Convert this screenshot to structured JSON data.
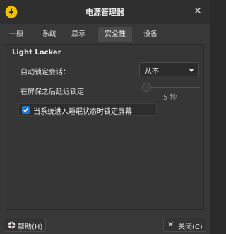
{
  "window": {
    "title": "电源管理器"
  },
  "tabs": [
    "一般",
    "系统",
    "显示",
    "安全性",
    "设备"
  ],
  "active_tab": "安全性",
  "section": {
    "title": "Light Locker"
  },
  "auto_lock": {
    "label": "自动锁定会话：",
    "value": "从不"
  },
  "delay": {
    "label": "在屏保之后延迟锁定",
    "value_text": "5 秒"
  },
  "sleep_lock": {
    "label": "当系统进入睡眠状态时锁定屏幕",
    "checked": true
  },
  "buttons": {
    "help": "帮助(H)",
    "close": "关闭(C)"
  },
  "colors": {
    "accent": "#1e7ad6",
    "icon_yellow": "#f2c200"
  }
}
